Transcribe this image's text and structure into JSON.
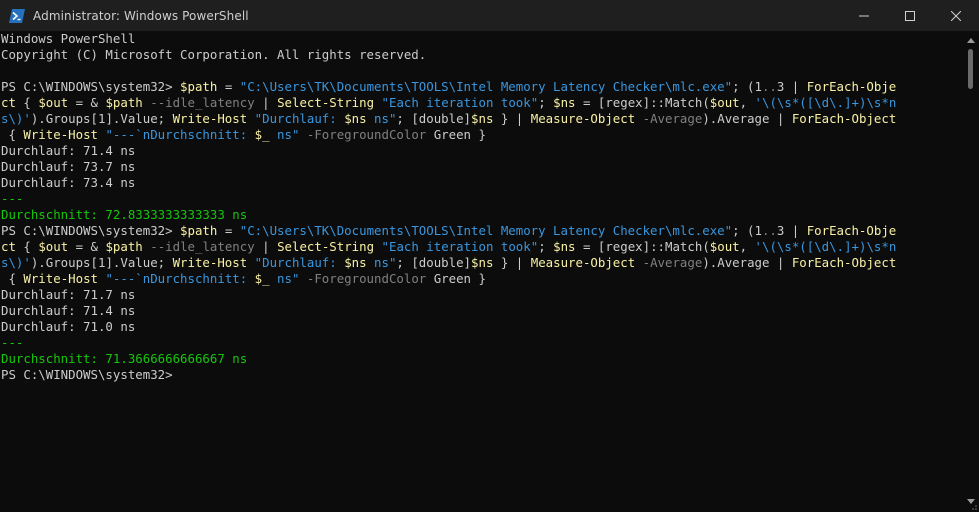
{
  "window": {
    "title": "Administrator: Windows PowerShell",
    "icon": "powershell-icon",
    "controls": [
      "minimize-icon",
      "maximize-icon",
      "close-icon"
    ]
  },
  "terminal": {
    "banner1": "Windows PowerShell",
    "banner2": "Copyright (C) Microsoft Corporation. All rights reserved.",
    "prompt": "PS C:\\WINDOWS\\system32> ",
    "cmd1": {
      "l1": [
        {
          "c": "y",
          "t": "$path"
        },
        {
          "c": "w",
          "t": " = "
        },
        {
          "c": "s",
          "t": "\"C:\\Users\\TK\\Documents\\TOOLS\\Intel Memory Latency Checker\\mlc.exe\""
        },
        {
          "c": "w",
          "t": "; (1"
        },
        {
          "c": "g",
          "t": ".."
        },
        {
          "c": "w",
          "t": "3 | "
        },
        {
          "c": "y",
          "t": "ForEach-Obje"
        }
      ],
      "l2": [
        {
          "c": "y",
          "t": "ct"
        },
        {
          "c": "w",
          "t": " { "
        },
        {
          "c": "y",
          "t": "$out"
        },
        {
          "c": "w",
          "t": " = & "
        },
        {
          "c": "y",
          "t": "$path"
        },
        {
          "c": "g",
          "t": " --idle_latency"
        },
        {
          "c": "w",
          "t": " | "
        },
        {
          "c": "y",
          "t": "Select-String"
        },
        {
          "c": "s",
          "t": " \"Each iteration took\""
        },
        {
          "c": "w",
          "t": "; "
        },
        {
          "c": "y",
          "t": "$ns"
        },
        {
          "c": "w",
          "t": " = [regex]::Match("
        },
        {
          "c": "y",
          "t": "$out"
        },
        {
          "c": "w",
          "t": ", "
        },
        {
          "c": "s",
          "t": "'\\(\\s*([\\d\\.]+)\\s*n"
        }
      ],
      "l3": [
        {
          "c": "s",
          "t": "s\\)'"
        },
        {
          "c": "w",
          "t": ").Groups[1].Value; "
        },
        {
          "c": "y",
          "t": "Write-Host"
        },
        {
          "c": "s",
          "t": " \"Durchlauf: "
        },
        {
          "c": "y",
          "t": "$ns"
        },
        {
          "c": "s",
          "t": " ns\""
        },
        {
          "c": "w",
          "t": "; [double]"
        },
        {
          "c": "y",
          "t": "$ns"
        },
        {
          "c": "w",
          "t": " } | "
        },
        {
          "c": "y",
          "t": "Measure-Object"
        },
        {
          "c": "g",
          "t": " -Average"
        },
        {
          "c": "w",
          "t": ").Average | "
        },
        {
          "c": "y",
          "t": "ForEach-Object"
        }
      ],
      "l4": [
        {
          "c": "w",
          "t": " { "
        },
        {
          "c": "y",
          "t": "Write-Host"
        },
        {
          "c": "s",
          "t": " \"---`nDurchschnitt: "
        },
        {
          "c": "y",
          "t": "$_"
        },
        {
          "c": "s",
          "t": " ns\""
        },
        {
          "c": "g",
          "t": " -ForegroundColor"
        },
        {
          "c": "w",
          "t": " Green }"
        }
      ]
    },
    "run1": {
      "r1": "Durchlauf: 71.4 ns",
      "r2": "Durchlauf: 73.7 ns",
      "r3": "Durchlauf: 73.4 ns",
      "sep": "---",
      "avg": "Durchschnitt: 72.8333333333333 ns"
    },
    "run2": {
      "r1": "Durchlauf: 71.7 ns",
      "r2": "Durchlauf: 71.4 ns",
      "r3": "Durchlauf: 71.0 ns",
      "sep": "---",
      "avg": "Durchschnitt: 71.3666666666667 ns"
    }
  },
  "colors": {
    "background": "#0c0c0c",
    "titlebar": "#1f1f1f",
    "default_text": "#cccccc",
    "command": "#f9f1a5",
    "string": "#3a96dd",
    "parameter": "#808080",
    "green": "#16c60c"
  }
}
